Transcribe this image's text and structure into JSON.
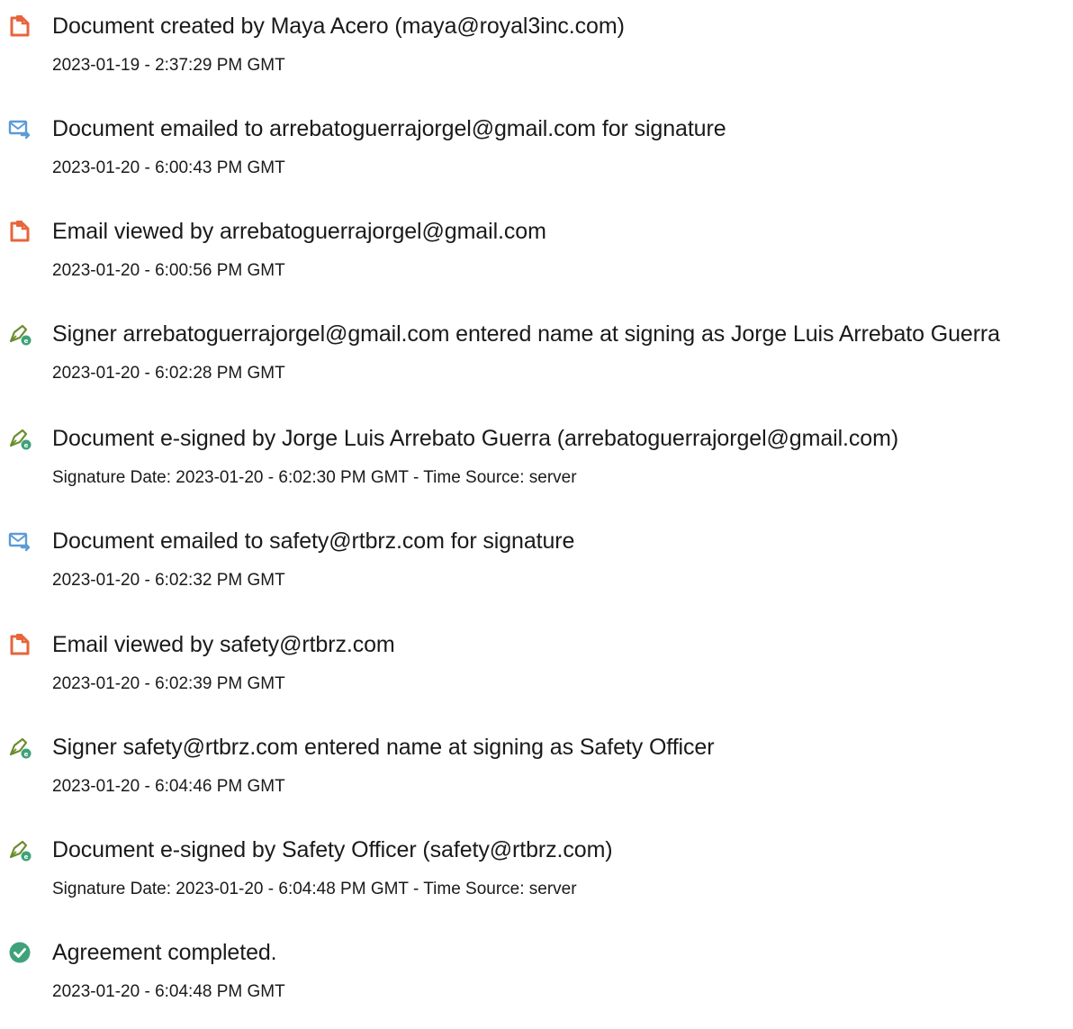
{
  "colors": {
    "doc_icon": "#E8643C",
    "email_icon": "#5B9BD5",
    "sign_icon": "#6C8C2E",
    "sign_badge": "#3FA27A",
    "check_icon": "#3FA27A"
  },
  "events": [
    {
      "icon": "document-icon",
      "title": "Document created by Maya Acero (maya@royal3inc.com)",
      "stamp": "2023-01-19 - 2:37:29 PM GMT"
    },
    {
      "icon": "email-icon",
      "title": "Document emailed to arrebatoguerrajorgel@gmail.com for signature",
      "stamp": "2023-01-20 - 6:00:43 PM GMT"
    },
    {
      "icon": "document-icon",
      "title": "Email viewed by arrebatoguerrajorgel@gmail.com",
      "stamp": "2023-01-20 - 6:00:56 PM GMT"
    },
    {
      "icon": "signature-pen-icon",
      "title": "Signer arrebatoguerrajorgel@gmail.com entered name at signing as Jorge Luis Arrebato Guerra",
      "stamp": "2023-01-20 - 6:02:28 PM GMT"
    },
    {
      "icon": "signature-pen-icon",
      "title": "Document e-signed by Jorge Luis Arrebato Guerra (arrebatoguerrajorgel@gmail.com)",
      "stamp": "Signature Date: 2023-01-20 - 6:02:30 PM GMT - Time Source: server"
    },
    {
      "icon": "email-icon",
      "title": "Document emailed to safety@rtbrz.com for signature",
      "stamp": "2023-01-20 - 6:02:32 PM GMT"
    },
    {
      "icon": "document-icon",
      "title": "Email viewed by safety@rtbrz.com",
      "stamp": "2023-01-20 - 6:02:39 PM GMT"
    },
    {
      "icon": "signature-pen-icon",
      "title": "Signer safety@rtbrz.com entered name at signing as Safety Officer",
      "stamp": "2023-01-20 - 6:04:46 PM GMT"
    },
    {
      "icon": "signature-pen-icon",
      "title": "Document e-signed by Safety Officer (safety@rtbrz.com)",
      "stamp": "Signature Date: 2023-01-20 - 6:04:48 PM GMT - Time Source: server"
    },
    {
      "icon": "check-circle-icon",
      "title": "Agreement completed.",
      "stamp": "2023-01-20 - 6:04:48 PM GMT"
    }
  ]
}
